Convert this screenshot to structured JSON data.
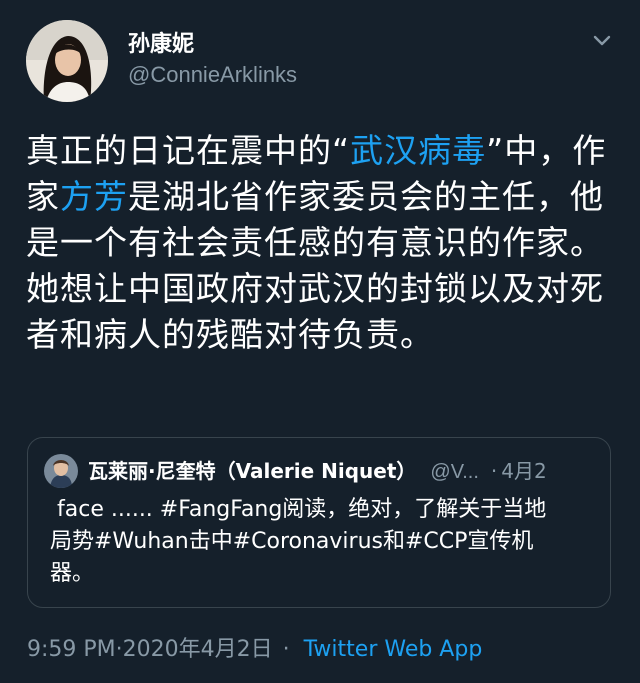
{
  "author": {
    "name": "孙康妮",
    "handle": "@ConnieArklinks"
  },
  "tweet": {
    "text_1": "真正的日记在震中的“",
    "link_1": "武汉病毒",
    "text_2": "”中，作家",
    "link_2": "方芳",
    "text_3": "是湖北省作家委员会的主任，他是一个有社会责任感的有意识的作家。她想让中国政府对武汉的封锁以及对死者和病人的残酷对待负责。"
  },
  "quoted_tweet": {
    "name": "瓦莱丽·尼奎特（Valerie Niquet）",
    "handle": "@V...",
    "separator": "·",
    "date": "4月2",
    "line_1": " face ...... #FangFang阅读，绝对，了解关于当地",
    "line_2": "局势#Wuhan击中#Coronavirus和#CCP宣传机",
    "line_3": "器。"
  },
  "meta": {
    "timestamp": "9:59 PM·2020年4月2日",
    "separator": "·",
    "source": "Twitter Web App"
  },
  "colors": {
    "background": "#15202b",
    "link": "#1da1f2",
    "muted": "#8899a6",
    "border": "#38444d"
  },
  "icons": {
    "menu": "chevron-down-icon"
  }
}
